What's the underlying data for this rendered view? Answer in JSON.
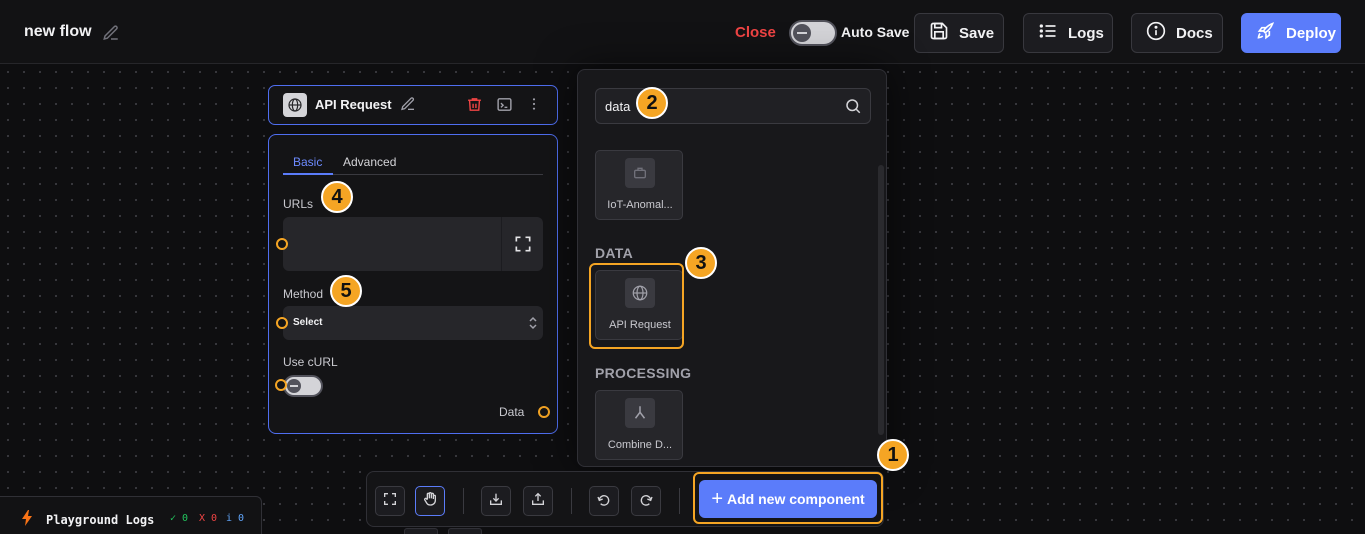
{
  "header": {
    "flow_title": "new flow",
    "close_label": "Close",
    "autosave_label": "Auto Save",
    "save_label": "Save",
    "logs_label": "Logs",
    "docs_label": "Docs",
    "deploy_label": "Deploy"
  },
  "node": {
    "title": "API Request",
    "tabs": {
      "basic": "Basic",
      "advanced": "Advanced"
    },
    "fields": {
      "urls_label": "URLs",
      "method_label": "Method",
      "method_value": "Select",
      "curl_label": "Use cURL",
      "output_label": "Data"
    }
  },
  "panel": {
    "search_value": "data",
    "top_component": "IoT-Anomal...",
    "sections": [
      {
        "title": "DATA",
        "component": "API Request"
      },
      {
        "title": "PROCESSING",
        "component": "Combine D..."
      }
    ]
  },
  "toolbar": {
    "add_label": "Add new component",
    "add_icon": "+"
  },
  "playground": {
    "title": "Playground Logs",
    "success_count": "✓ 0",
    "error_count": "X 0",
    "info_count": "i 0"
  },
  "annotations": [
    "1",
    "2",
    "3",
    "4",
    "5"
  ],
  "colors": {
    "accent": "#5b7cfa",
    "highlight": "#f5a524",
    "danger": "#ef4444"
  }
}
